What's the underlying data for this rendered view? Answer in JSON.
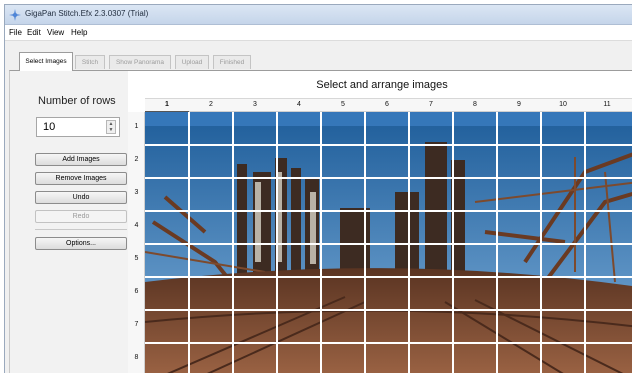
{
  "window": {
    "title": "GigaPan Stitch.Efx 2.3.0307 (Trial)"
  },
  "menu": [
    "File",
    "Edit",
    "View",
    "Help"
  ],
  "tabs": [
    {
      "label": "Select Images",
      "active": true
    },
    {
      "label": "Stitch",
      "active": false
    },
    {
      "label": "Show Panorama",
      "active": false
    },
    {
      "label": "Upload",
      "active": false
    },
    {
      "label": "Finished",
      "active": false
    }
  ],
  "left_panel": {
    "rows_label": "Number of rows",
    "rows_value": "10",
    "buttons": {
      "add": "Add Images",
      "remove": "Remove Images",
      "undo": "Undo",
      "redo": "Redo",
      "options": "Options..."
    }
  },
  "grid": {
    "title": "Select and arrange images",
    "columns": [
      "1",
      "2",
      "3",
      "4",
      "5",
      "6",
      "7",
      "8",
      "9",
      "10",
      "11"
    ],
    "rows": [
      "1",
      "2",
      "3",
      "4",
      "5",
      "6",
      "7",
      "8"
    ]
  },
  "colors": {
    "sky_top": "#1e5d9a",
    "sky_bottom": "#6fa6d6",
    "rust": "#6a3a22",
    "ground": "#8a4f33",
    "grid_line": "#ffffff"
  }
}
